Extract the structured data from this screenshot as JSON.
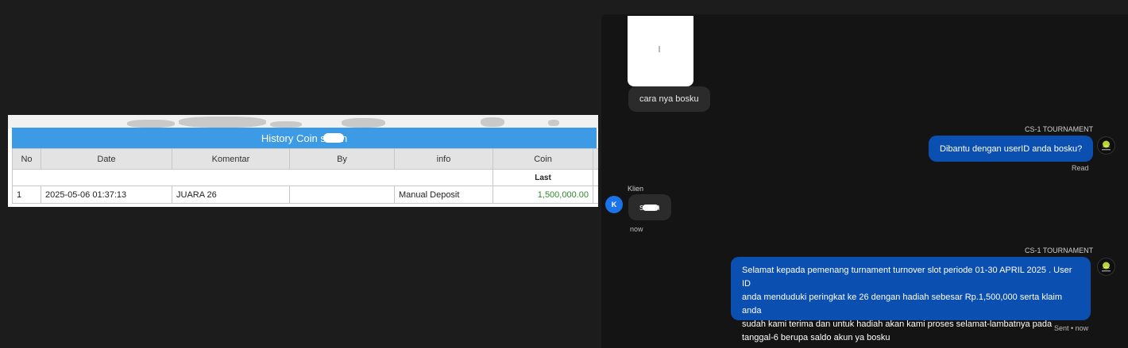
{
  "history": {
    "title_prefix": "History Coin s",
    "title_suffix": "n",
    "columns": [
      "No",
      "Date",
      "Komentar",
      "By",
      "info",
      "Coin"
    ],
    "sub_header_label": "Last",
    "rows": [
      {
        "no": "1",
        "date": "2025-05-06 01:37:13",
        "komentar": "JUARA 26",
        "by": "",
        "info": "Manual Deposit",
        "coin": "1,500,000.00"
      }
    ],
    "colors": {
      "header_bar": "#3d9ae5",
      "coin_value": "#2e8a2e"
    }
  },
  "chat": {
    "messages": [
      {
        "direction": "in",
        "text": "cara nya bosku"
      },
      {
        "direction": "out",
        "sender": "CS-1 TOURNAMENT",
        "text": "Dibantu dengan userID anda bosku?",
        "status": "Read"
      },
      {
        "direction": "in",
        "sender": "Klien",
        "avatar_letter": "K",
        "text_prefix": "s",
        "text_suffix": "n",
        "time": "now"
      },
      {
        "direction": "out",
        "sender": "CS-1 TOURNAMENT",
        "lines": [
          "Selamat kepada pemenang turnament turnover slot periode 01-30 APRIL 2025 . User ID",
          "anda menduduki peringkat ke 26 dengan hadiah sebesar Rp.1,500,000 serta klaim anda",
          "sudah kami terima dan untuk hadiah akan kami proses selamat-lambatnya pada",
          "tanggal-6 berupa saldo akun ya bosku"
        ],
        "status": "Sent • now"
      }
    ],
    "colors": {
      "outgoing_bubble": "#0b4fb0",
      "incoming_bubble": "#2b2b2b",
      "avatar": "#1a73e8"
    }
  }
}
